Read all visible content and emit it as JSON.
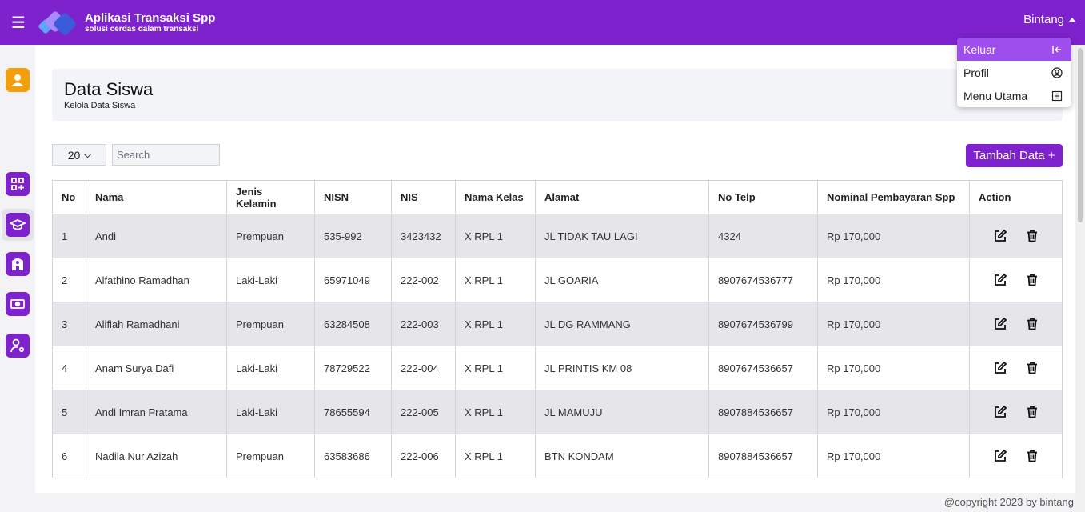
{
  "app": {
    "title": "Aplikasi Transaksi Spp",
    "subtitle": "solusi cerdas dalam transaksi",
    "user": "Bintang"
  },
  "menu": {
    "items": [
      {
        "label": "Keluar",
        "icon": "logout-icon"
      },
      {
        "label": "Profil",
        "icon": "user-circle-icon"
      },
      {
        "label": "Menu Utama",
        "icon": "list-icon"
      }
    ]
  },
  "sidebar": {
    "icons": [
      "user-icon",
      "dashboard-icon",
      "graduation-icon",
      "school-icon",
      "money-icon",
      "user-settings-icon"
    ]
  },
  "page": {
    "title": "Data Siswa",
    "subtitle": "Kelola Data Siswa"
  },
  "controls": {
    "per_page": "20",
    "search_placeholder": "Search",
    "add_label": "Tambah Data +"
  },
  "table": {
    "headers": [
      "No",
      "Nama",
      "Jenis Kelamin",
      "NISN",
      "NIS",
      "Nama Kelas",
      "Alamat",
      "No Telp",
      "Nominal Pembayaran Spp",
      "Action"
    ],
    "rows": [
      [
        "1",
        "Andi",
        "Prempuan",
        "535-992",
        "3423432",
        "X RPL 1",
        "JL TIDAK TAU LAGI",
        "4324",
        "Rp 170,000"
      ],
      [
        "2",
        "Alfathino Ramadhan",
        "Laki-Laki",
        "65971049",
        "222-002",
        "X RPL 1",
        "JL GOARIA",
        "8907674536777",
        "Rp 170,000"
      ],
      [
        "3",
        "Alifiah Ramadhani",
        "Prempuan",
        "63284508",
        "222-003",
        "X RPL 1",
        "JL DG RAMMANG",
        "8907674536799",
        "Rp 170,000"
      ],
      [
        "4",
        "Anam Surya Dafi",
        "Laki-Laki",
        "78729522",
        "222-004",
        "X RPL 1",
        "JL PRINTIS KM 08",
        "8907674536657",
        "Rp 170,000"
      ],
      [
        "5",
        "Andi Imran Pratama",
        "Laki-Laki",
        "78655594",
        "222-005",
        "X RPL 1",
        "JL MAMUJU",
        "8907884536657",
        "Rp 170,000"
      ],
      [
        "6",
        "Nadila Nur Azizah",
        "Prempuan",
        "63583686",
        "222-006",
        "X RPL 1",
        "BTN KONDAM",
        "8907884536657",
        "Rp 170,000"
      ]
    ]
  },
  "footer": {
    "text": "@copyright 2023 by bintang"
  },
  "colors": {
    "primary": "#7e22ce",
    "menu_active": "#9d4eed",
    "avatar": "#f59e0b"
  }
}
